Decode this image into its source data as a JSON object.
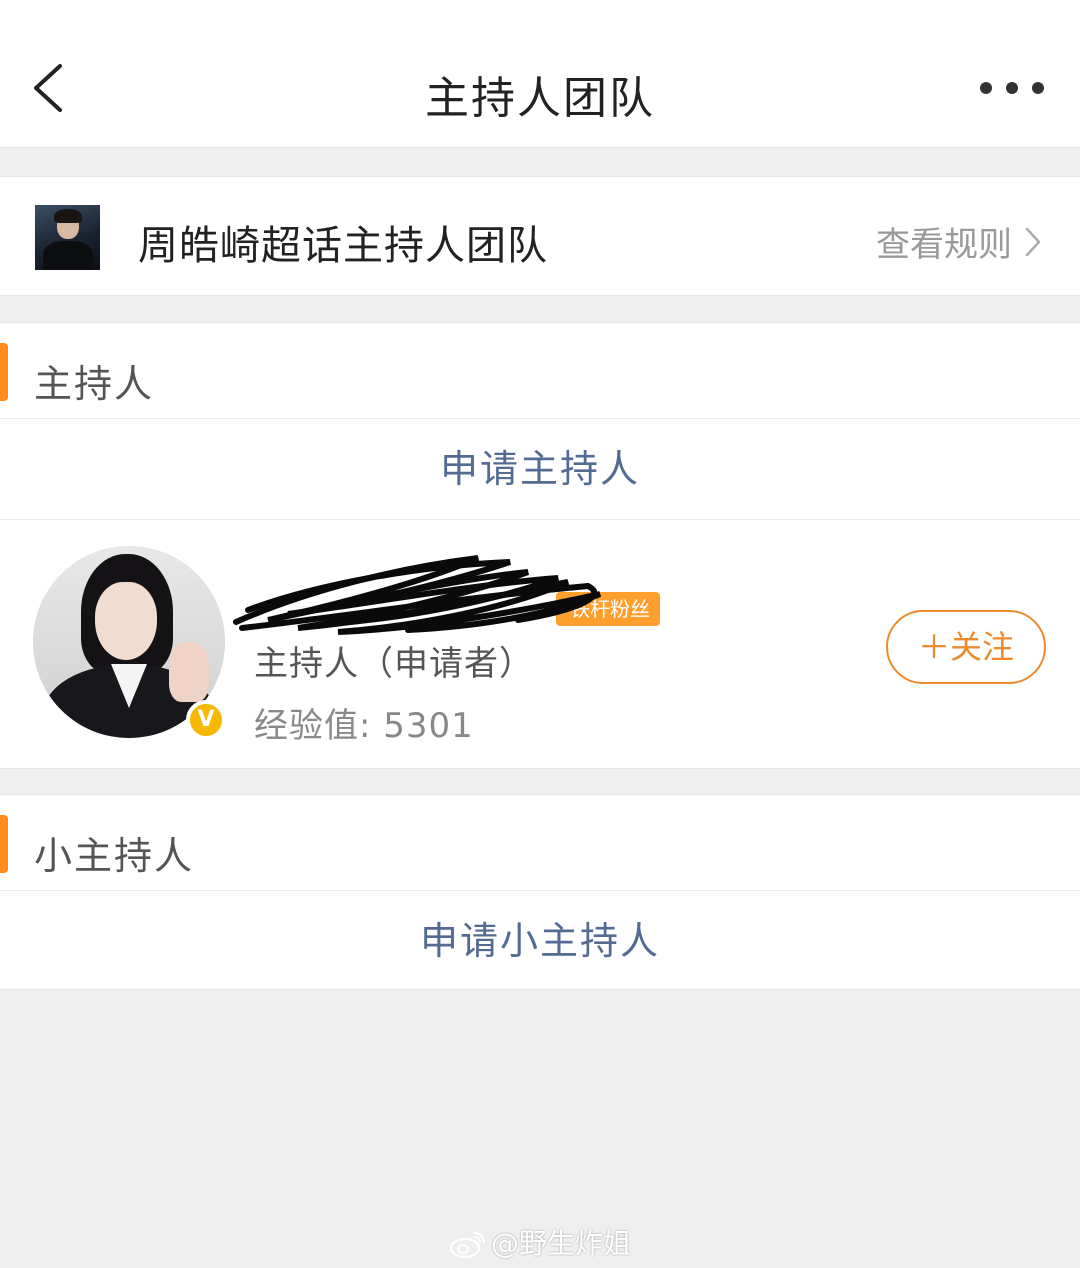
{
  "nav": {
    "title": "主持人团队"
  },
  "team": {
    "name": "周皓崎超话主持人团队",
    "rules_label": "查看规则"
  },
  "sections": [
    {
      "title": "主持人",
      "apply_label": "申请主持人",
      "members": [
        {
          "name": "",
          "fan_badge": "铁杆粉丝",
          "role": "主持人（申请者）",
          "exp": "经验值: 5301",
          "follow_label": "＋关注",
          "verified_icon": "verified-v-icon"
        }
      ]
    },
    {
      "title": "小主持人",
      "apply_label": "申请小主持人",
      "members": []
    }
  ],
  "watermark": "@野生炸姐",
  "colors": {
    "accent_orange": "#ff8a1e",
    "link_blue": "#536b92",
    "follow_orange": "#ee8a2e",
    "verified_yellow": "#f6b800"
  }
}
